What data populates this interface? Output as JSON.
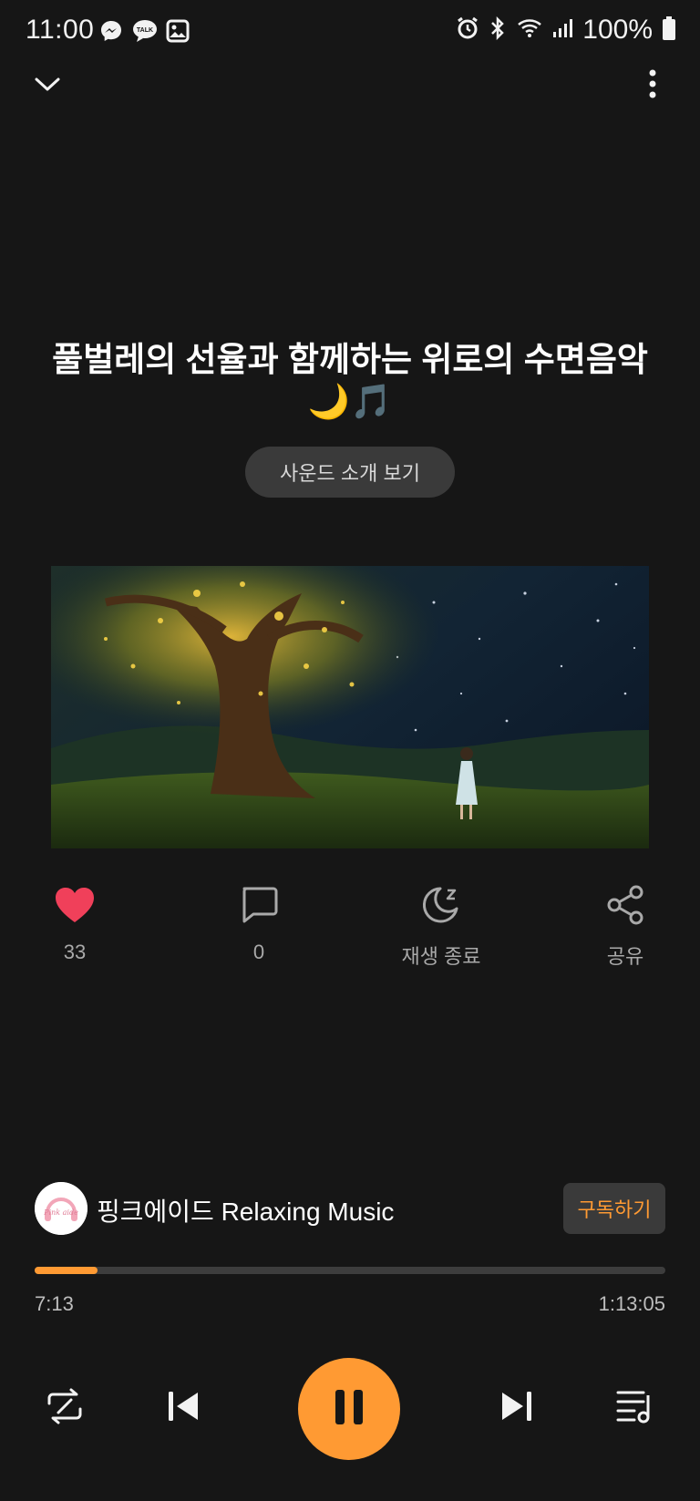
{
  "status_bar": {
    "time": "11:00",
    "battery": "100%",
    "left_icons": [
      "messenger-icon",
      "kakaotalk-icon",
      "gallery-icon"
    ],
    "right_icons": [
      "alarm-icon",
      "bluetooth-icon",
      "wifi-icon",
      "signal-icon",
      "battery-icon"
    ]
  },
  "header": {
    "collapse_icon": "chevron-down-icon",
    "menu_icon": "more-vertical-icon"
  },
  "track": {
    "title": "풀벌레의 선율과 함께하는 위로의 수면음악 🌙🎵",
    "intro_button": "사운드 소개 보기",
    "artwork": "night-tree-girl-illustration"
  },
  "actions": {
    "like_count": "33",
    "comment_count": "0",
    "sleep_timer_label": "재생 종료",
    "share_label": "공유"
  },
  "channel": {
    "name": "핑크에이드 Relaxing Music",
    "avatar_text": "Pink aide",
    "subscribe_label": "구독하기"
  },
  "playback": {
    "elapsed": "7:13",
    "total": "1:13:05",
    "progress_fraction": 0.099
  },
  "colors": {
    "accent": "#ff9a33",
    "background": "#161616",
    "like": "#f0405a"
  }
}
